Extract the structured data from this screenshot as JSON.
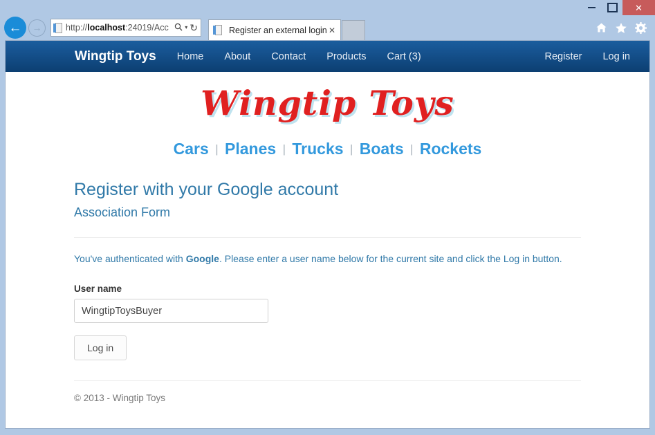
{
  "window": {
    "controls": {
      "minimize": "–",
      "maximize": "❐",
      "close": "✕"
    }
  },
  "browser": {
    "back_icon": "←",
    "forward_icon": "→",
    "address": {
      "scheme": "http://",
      "host": "localhost",
      "path": ":24019/Acc",
      "full_text": "http://localhost:24019/Acc",
      "search_icon": "🔍",
      "caret_icon": "▾",
      "refresh_icon": "↻"
    },
    "tab": {
      "title": "Register an external login - ...",
      "close_icon": "✕"
    },
    "toolbar_icons": [
      "home-icon",
      "favorites-star-icon",
      "settings-gear-icon"
    ]
  },
  "site": {
    "brand": "Wingtip Toys",
    "nav_links": [
      {
        "label": "Home"
      },
      {
        "label": "About"
      },
      {
        "label": "Contact"
      },
      {
        "label": "Products"
      },
      {
        "label": "Cart (3)"
      }
    ],
    "nav_right": [
      {
        "label": "Register"
      },
      {
        "label": "Log in"
      }
    ],
    "logo_text": "Wingtip Toys",
    "categories": [
      {
        "label": "Cars"
      },
      {
        "label": "Planes"
      },
      {
        "label": "Trucks"
      },
      {
        "label": "Boats"
      },
      {
        "label": "Rockets"
      }
    ],
    "category_separator": "|"
  },
  "page": {
    "title": "Register with your Google account",
    "subtitle": "Association Form",
    "lede_before": "You've authenticated with ",
    "lede_provider": "Google",
    "lede_after": ". Please enter a user name below for the current site and click the Log in button.",
    "form": {
      "username_label": "User name",
      "username_value": "WingtipToysBuyer",
      "username_placeholder": "",
      "submit_label": "Log in"
    },
    "footer": "© 2013 - Wingtip Toys"
  },
  "colors": {
    "navbar_top": "#1b5d9e",
    "navbar_bottom": "#0c3f72",
    "logo_red": "#e02020",
    "logo_shadow": "#bfe3ef",
    "category_blue": "#3399dd",
    "heading_blue": "#3079a8",
    "close_red": "#c75b5b",
    "chrome_blue": "#b0c8e4"
  }
}
